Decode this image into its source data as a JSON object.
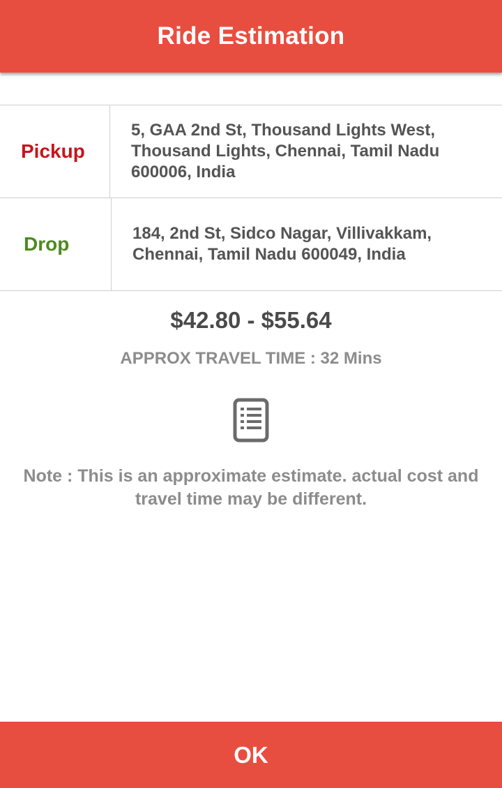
{
  "header": {
    "title": "Ride Estimation",
    "background_color": "#e84e3f"
  },
  "locations": {
    "pickup": {
      "label": "Pickup",
      "label_color": "#c8141c",
      "address": "5, GAA 2nd St, Thousand Lights West, Thousand Lights, Chennai, Tamil Nadu 600006, India"
    },
    "drop": {
      "label": "Drop",
      "label_color": "#4c8a1e",
      "address": "184, 2nd St, Sidco Nagar, Villivakkam, Chennai, Tamil Nadu 600049, India"
    }
  },
  "estimate": {
    "price_range": "$42.80 - $55.64",
    "travel_time": "APPROX TRAVEL TIME : 32 Mins",
    "icon": "document-list-icon",
    "note": "Note : This is an approximate estimate. actual cost and travel time may be different."
  },
  "footer": {
    "ok_label": "OK",
    "background_color": "#e84e3f"
  }
}
